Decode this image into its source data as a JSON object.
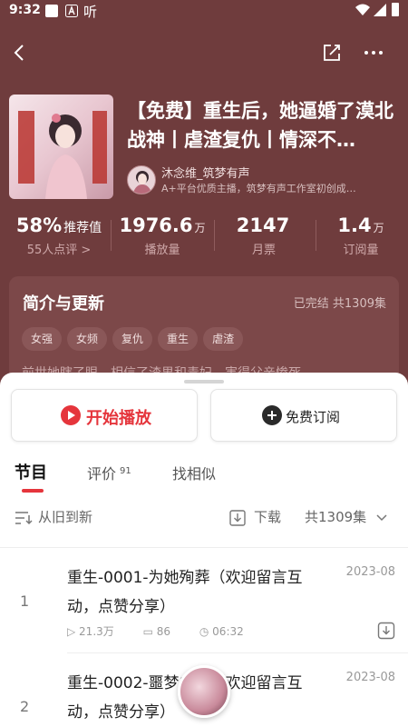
{
  "status_bar": {
    "time": "9:32",
    "ting": "听"
  },
  "book": {
    "title": "【免费】重生后，她逼婚了漠北战神丨虐渣复仇丨情深不…",
    "anchor_name": "沐念维_筑梦有声",
    "anchor_desc": "A+平台优质主播，筑梦有声工作室初创成…"
  },
  "stats": [
    {
      "value": "58%",
      "unit": "推荐值",
      "label": "55人点评 >"
    },
    {
      "value": "1976.6",
      "unit": "万",
      "label": "播放量"
    },
    {
      "value": "2147",
      "unit": "",
      "label": "月票"
    },
    {
      "value": "1.4",
      "unit": "万",
      "label": "订阅量"
    }
  ],
  "intro": {
    "title": "简介与更新",
    "status": "已完结 共1309集",
    "tags": [
      "女强",
      "女频",
      "复仇",
      "重生",
      "虐渣"
    ],
    "text": "前世她瞎了眼，相信了渣男和毒妇，害得父亲惨死…"
  },
  "actions": {
    "play": "开始播放",
    "subscribe": "免费订阅"
  },
  "tabs": {
    "episodes": "节目",
    "reviews": "评价",
    "reviews_count": "91",
    "similar": "找相似"
  },
  "toolbar": {
    "sort": "从旧到新",
    "download": "下载",
    "count": "共1309集"
  },
  "episodes": [
    {
      "index": "1",
      "title": "重生-0001-为她殉葬（欢迎留言互动，点赞分享）",
      "date": "2023-08",
      "plays": "21.3万",
      "comments": "86",
      "duration": "06:32"
    },
    {
      "index": "2",
      "title": "重生-0002-噩梦成真（欢迎留言互动，点赞分享）",
      "date": "2023-08",
      "plays": "",
      "comments": "",
      "duration": ""
    }
  ],
  "colors": {
    "header_bg": "#6f3c3d",
    "accent": "#e5353c"
  }
}
